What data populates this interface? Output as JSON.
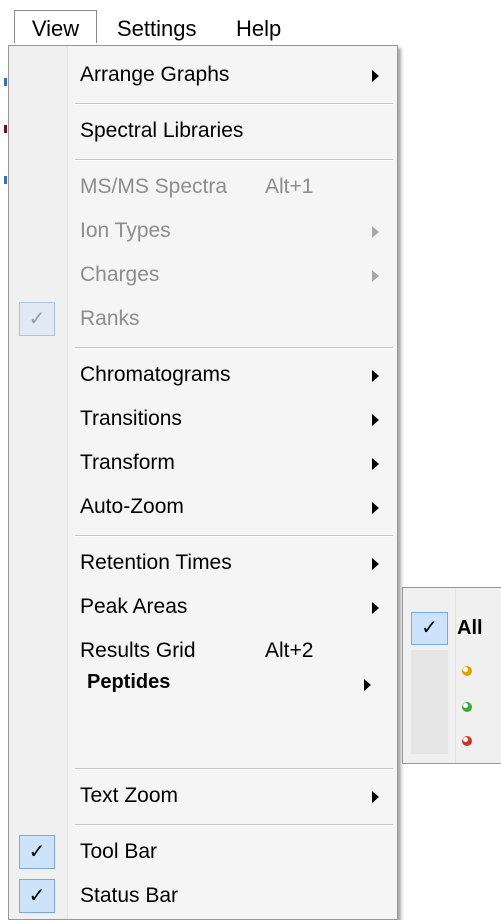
{
  "menubar": {
    "items": [
      {
        "label": "View"
      },
      {
        "label": "Settings"
      },
      {
        "label": "Help"
      }
    ]
  },
  "view_menu": {
    "arrange_graphs": "Arrange Graphs",
    "spectral_libraries": "Spectral Libraries",
    "msms_spectra": "MS/MS Spectra",
    "msms_shortcut": "Alt+1",
    "ion_types": "Ion Types",
    "charges": "Charges",
    "ranks": "Ranks",
    "chromatograms": "Chromatograms",
    "transitions": "Transitions",
    "transform": "Transform",
    "auto_zoom": "Auto-Zoom",
    "retention_times": "Retention Times",
    "peak_areas": "Peak Areas",
    "results_grid": "Results Grid",
    "results_grid_shortcut": "Alt+2",
    "peptides": "Peptides",
    "text_zoom": "Text Zoom",
    "tool_bar": "Tool Bar",
    "status_bar": "Status Bar",
    "check_glyph": "✓"
  },
  "peptides_submenu": {
    "all_label": "All",
    "dot_colors": [
      "#e0a000",
      "#3fa83a",
      "#c8332a"
    ]
  }
}
